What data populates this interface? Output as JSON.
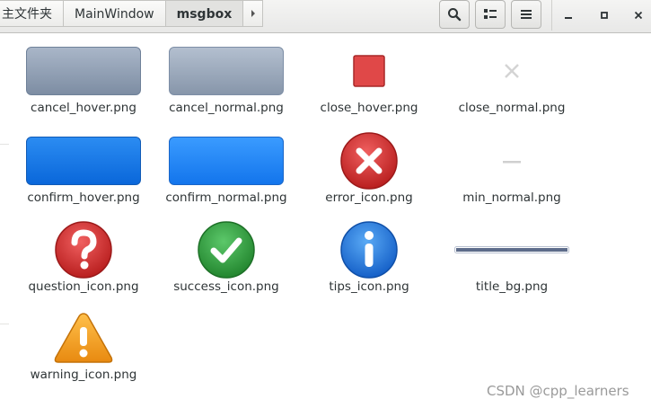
{
  "breadcrumb": {
    "items": [
      "主文件夹",
      "MainWindow",
      "msgbox"
    ]
  },
  "toolbar": {
    "search": "search-icon",
    "view": "list-view-icon",
    "menu": "hamburger-menu-icon"
  },
  "window_controls": [
    "minimize-icon",
    "maximize-icon",
    "close-icon"
  ],
  "files": [
    {
      "name": "cancel_hover.png"
    },
    {
      "name": "cancel_normal.png"
    },
    {
      "name": "close_hover.png"
    },
    {
      "name": "close_normal.png"
    },
    {
      "name": "confirm_hover.png"
    },
    {
      "name": "confirm_normal.png"
    },
    {
      "name": "error_icon.png"
    },
    {
      "name": "min_normal.png"
    },
    {
      "name": "question_icon.png"
    },
    {
      "name": "success_icon.png"
    },
    {
      "name": "tips_icon.png"
    },
    {
      "name": "title_bg.png"
    },
    {
      "name": "warning_icon.png"
    }
  ],
  "watermark": "CSDN @cpp_learners",
  "colors": {
    "error_red": "#d93a3a",
    "success_green": "#3aa84a",
    "info_blue": "#1e82e6",
    "warning_orange": "#f0a020",
    "confirm_blue": "#1a7ff0"
  }
}
